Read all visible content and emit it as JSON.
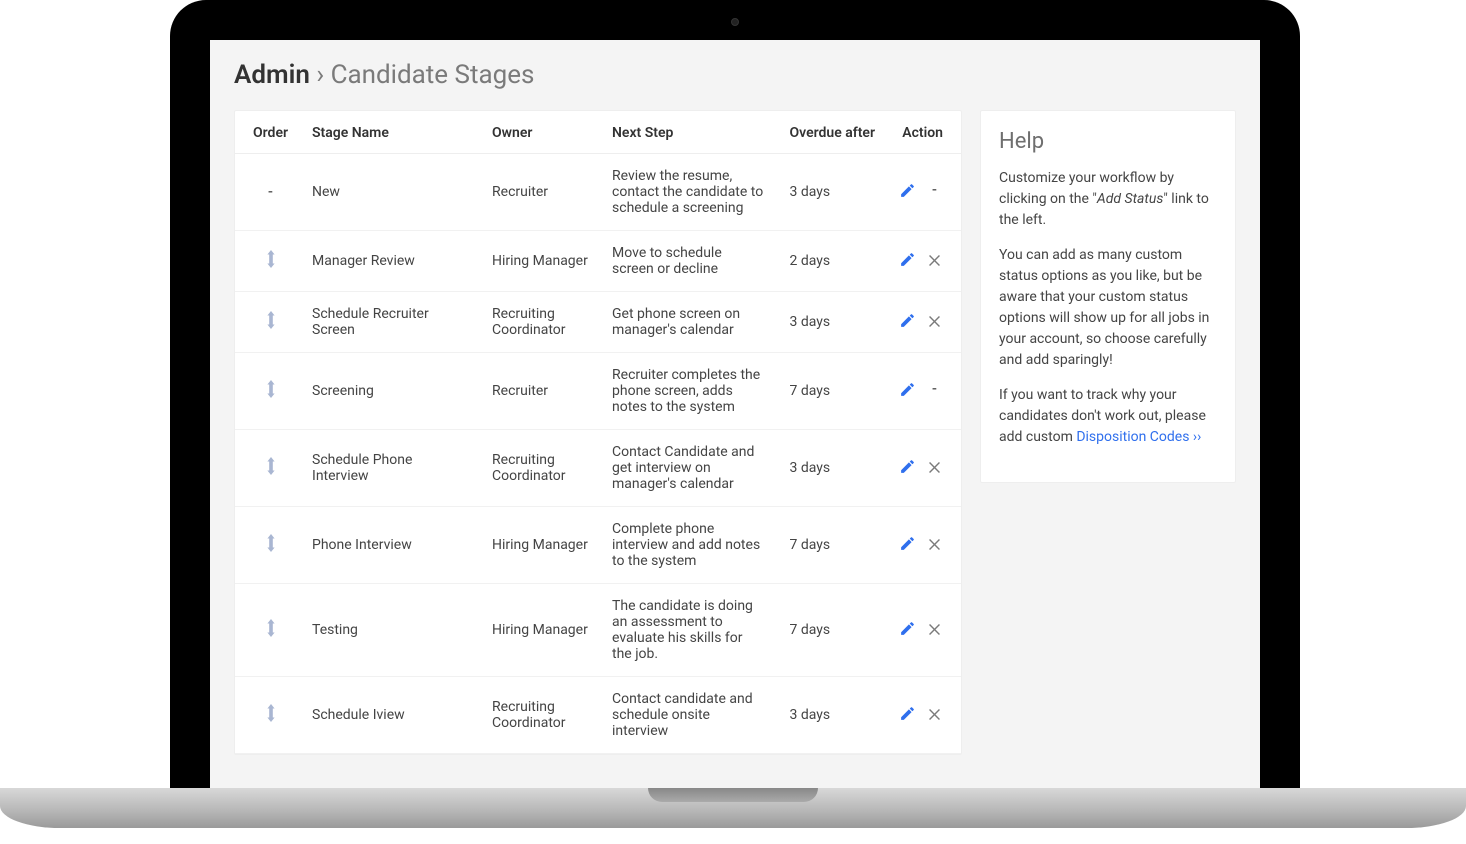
{
  "breadcrumb": {
    "root": "Admin",
    "separator": "›",
    "current": "Candidate Stages"
  },
  "table": {
    "headers": {
      "order": "Order",
      "name": "Stage Name",
      "owner": "Owner",
      "next": "Next Step",
      "overdue": "Overdue after",
      "action": "Action"
    },
    "rows": [
      {
        "draggable": false,
        "name": "New",
        "owner": "Recruiter",
        "next": "Review the resume, contact the candidate to schedule a screening",
        "overdue": "3 days",
        "deletable": false
      },
      {
        "draggable": true,
        "name": "Manager Review",
        "owner": "Hiring Manager",
        "next": "Move to schedule screen or decline",
        "overdue": "2 days",
        "deletable": true
      },
      {
        "draggable": true,
        "name": "Schedule Recruiter Screen",
        "owner": "Recruiting Coordinator",
        "next": "Get phone screen on manager's calendar",
        "overdue": "3 days",
        "deletable": true
      },
      {
        "draggable": true,
        "name": "Screening",
        "owner": "Recruiter",
        "next": "Recruiter completes the phone screen, adds notes to the system",
        "overdue": "7 days",
        "deletable": false
      },
      {
        "draggable": true,
        "name": "Schedule Phone Interview",
        "owner": "Recruiting Coordinator",
        "next": "Contact Candidate and get interview on manager's calendar",
        "overdue": "3 days",
        "deletable": true
      },
      {
        "draggable": true,
        "name": "Phone Interview",
        "owner": "Hiring Manager",
        "next": "Complete phone interview and add notes to the system",
        "overdue": "7 days",
        "deletable": true
      },
      {
        "draggable": true,
        "name": "Testing",
        "owner": "Hiring Manager",
        "next": "The candidate is doing an assessment to evaluate his skills for the job.",
        "overdue": "7 days",
        "deletable": true
      },
      {
        "draggable": true,
        "name": "Schedule Iview",
        "owner": "Recruiting Coordinator",
        "next": "Contact candidate and schedule onsite interview",
        "overdue": "3 days",
        "deletable": true
      }
    ]
  },
  "help": {
    "title": "Help",
    "p1_pre": "Customize your workflow by clicking on the \"",
    "p1_em": "Add Status",
    "p1_post": "\" link to the left.",
    "p2": "You can add as many custom status options as you like, but be aware that your custom status options will show up for all jobs in your account, so choose carefully and add sparingly!",
    "p3_pre": "If you want to track why your candidates don't work out, please add custom ",
    "p3_link": "Disposition Codes ››"
  }
}
